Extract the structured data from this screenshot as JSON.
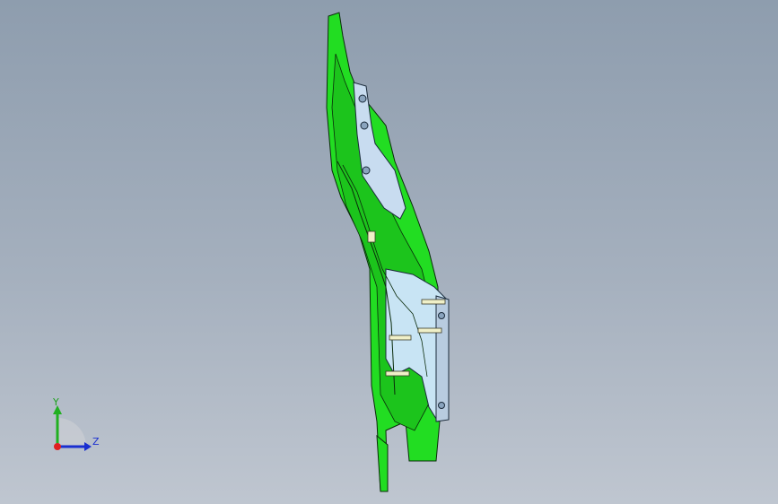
{
  "viewport": {
    "background_top": "#8e9dae",
    "background_bottom": "#bfc6d0"
  },
  "model": {
    "body_color": "#22dd22",
    "plate_color": "#c8dcf0",
    "edge_color": "#0a2a0a",
    "fastener_color": "#f0f0c8"
  },
  "triad": {
    "y_label": "Y",
    "z_label": "Z",
    "y_color": "#20b020",
    "z_color": "#1a2fd0",
    "x_color": "#e02020"
  }
}
